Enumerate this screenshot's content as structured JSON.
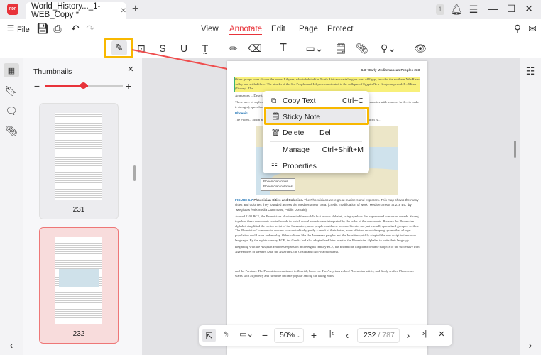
{
  "app": {
    "logo_text": "PDF",
    "accent": "#e8333a"
  },
  "tab": {
    "title": "World_History..._1-WEB_Copy *",
    "close": "✕",
    "new_tab": "+"
  },
  "window": {
    "badge": "1"
  },
  "menu": {
    "file": "File",
    "tabs": [
      "View",
      "Annotate",
      "Edit",
      "Page",
      "Protect"
    ],
    "active": "Annotate"
  },
  "toolbar": {
    "tools": [
      "highlight",
      "area-highlight",
      "strikethrough",
      "underline",
      "squiggly",
      "pencil",
      "eraser",
      "text",
      "shape",
      "sticky-note",
      "attachment",
      "stamp",
      "hide-annotations"
    ]
  },
  "thumbnails": {
    "title": "Thumbnails",
    "pages": [
      "231",
      "232"
    ],
    "selected": "232",
    "zoom_percent": 55
  },
  "pdf": {
    "header": "6.3 • Early Mediterranean Peoples   233",
    "highlighted": "Other groups were also on the move. Libyans, who inhabited the North African coastal region west of Egypt, invaded the northern Nile River valley and settled there. The attacks of the Sea Peoples and Libyans contributed to the collapse of Egypt's New Kingdom period. P... Minor (Turkey). The",
    "p1": "Aramaeans ... Desert, migrated into Syria and ...",
    "p2": "These wa... of sophisticated iron-maki... the ancient world. But the discu... to access tin, a crucial in... centuries with iron ore. In th... to make it stronger), quenchin... a metal far superior in strengt... terranean.",
    "heading": "Phoenici...",
    "p3": "The Phoen... Sidon and Tyre in today's L... who established trading posts in C... of Africa and to the British Is...",
    "legend": [
      "Phoenician cities",
      "Phoenician colonies"
    ],
    "caption_label": "FIGURE 6.7",
    "caption_title": "Phoenician Cities and Colonies.",
    "caption": "The Phoenicians were great mariners and explorers. This map shows the many cities and colonies they founded across the Mediterranean Sea. (credit: modification of work \"Mediterranean at 218 BC\" by \"Megistias\"/Wikimedia Commons, Public Domain)",
    "p4": "Around 1100 BCE, the Phoenicians also invented the world's first known alphabet, using symbols that represented consonant sounds. Strung together, these consonants created words in which vowel sounds were interpreted by the order of the consonants. Because the Phoenician alphabet simplified the earlier script of the Canaanites, more people could now become literate, not just a small, specialized group of scribes. The Phoenicians' commercial success was undoubtedly partly a result of their better, more efficient record-keeping system that a larger population could learn and employ. Other cultures like the Aramaean peoples and the Israelites quickly adapted the new script to their own languages. By the eighth century BCE, the Greeks had also adopted and later adapted the Phoenician alphabet to write their language.",
    "p5": "Beginning with the Assyrian Empire's expansion in the eighth century BCE, the Phoenician kingdoms became subjects of the successive Iron Age empires of western Asia: the Assyrians, the Chaldeans (Neo-Babylonians),",
    "p6": "and the Persians. The Phoenicians continued to flourish, however. The Assyrians valued Phoenician artists, and finely crafted Phoenician wares such as jewelry and furniture became popular among the ruling elites."
  },
  "context_menu": [
    {
      "label": "Copy Text",
      "shortcut": "Ctrl+C",
      "icon": "copy-icon"
    },
    {
      "label": "Sticky Note",
      "shortcut": "",
      "icon": "sticky-note-icon",
      "active": true
    },
    {
      "label": "Delete",
      "shortcut": "Del",
      "icon": "trash-icon"
    },
    {
      "label": "Manage",
      "shortcut": "Ctrl+Shift+M",
      "icon": ""
    },
    {
      "label": "Properties",
      "shortcut": "",
      "icon": "sliders-icon"
    }
  ],
  "bottom": {
    "zoom": "50%",
    "page": "232",
    "total": "/ 787"
  },
  "highlight_color": "#f8b800",
  "arrow_color": "#ef4d4d"
}
